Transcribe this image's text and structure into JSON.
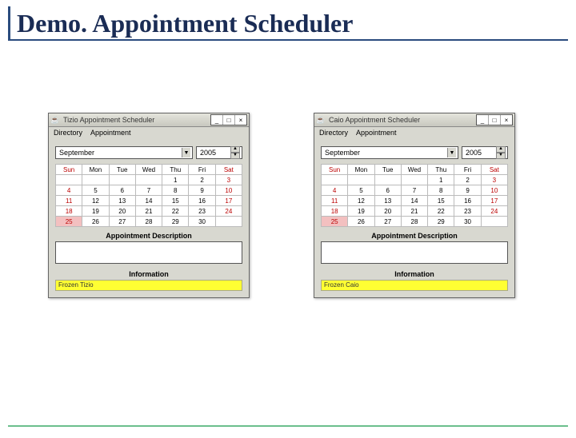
{
  "slide_title": "Demo. Appointment Scheduler",
  "icons": {
    "java": "☕",
    "min": "_",
    "max": "□",
    "close": "×",
    "down": "▼",
    "up": "▲"
  },
  "menus": [
    "Directory",
    "Appointment"
  ],
  "month_label": "September",
  "year_label": "2005",
  "day_headers": [
    "Sun",
    "Mon",
    "Tue",
    "Wed",
    "Thu",
    "Fri",
    "Sat"
  ],
  "cal_rows": [
    [
      "",
      "",
      "",
      "",
      "1",
      "2",
      "3"
    ],
    [
      "4",
      "5",
      "6",
      "7",
      "8",
      "9",
      "10"
    ],
    [
      "11",
      "12",
      "13",
      "14",
      "15",
      "16",
      "17"
    ],
    [
      "18",
      "19",
      "20",
      "21",
      "22",
      "23",
      "24"
    ],
    [
      "25",
      "26",
      "27",
      "28",
      "29",
      "30",
      ""
    ]
  ],
  "today_cell": "25",
  "labels": {
    "desc": "Appointment Description",
    "info": "Information"
  },
  "windows": [
    {
      "user": "Tizio",
      "info_text": "Frozen Tizio"
    },
    {
      "user": "Caio",
      "info_text": "Frozen Caio"
    }
  ]
}
